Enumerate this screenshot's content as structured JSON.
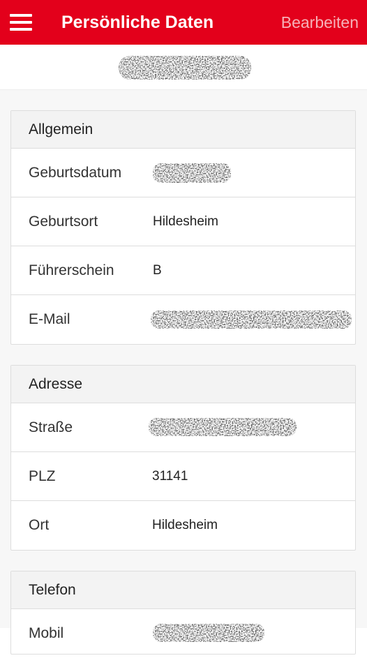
{
  "app_bar": {
    "title": "Persönliche Daten",
    "edit_label": "Bearbeiten",
    "menu_icon": "hamburger-menu-icon",
    "color": "#e3001b"
  },
  "sections": [
    {
      "title": "Allgemein",
      "rows": [
        {
          "label": "Geburtsdatum",
          "value": ""
        },
        {
          "label": "Geburtsort",
          "value": "Hildesheim"
        },
        {
          "label": "Führerschein",
          "value": "B"
        },
        {
          "label": "E-Mail",
          "value": ""
        }
      ]
    },
    {
      "title": "Adresse",
      "rows": [
        {
          "label": "Straße",
          "value": ""
        },
        {
          "label": "PLZ",
          "value": "31141"
        },
        {
          "label": "Ort",
          "value": "Hildesheim"
        }
      ]
    },
    {
      "title": "Telefon",
      "rows": [
        {
          "label": "Mobil",
          "value": ""
        }
      ]
    }
  ]
}
